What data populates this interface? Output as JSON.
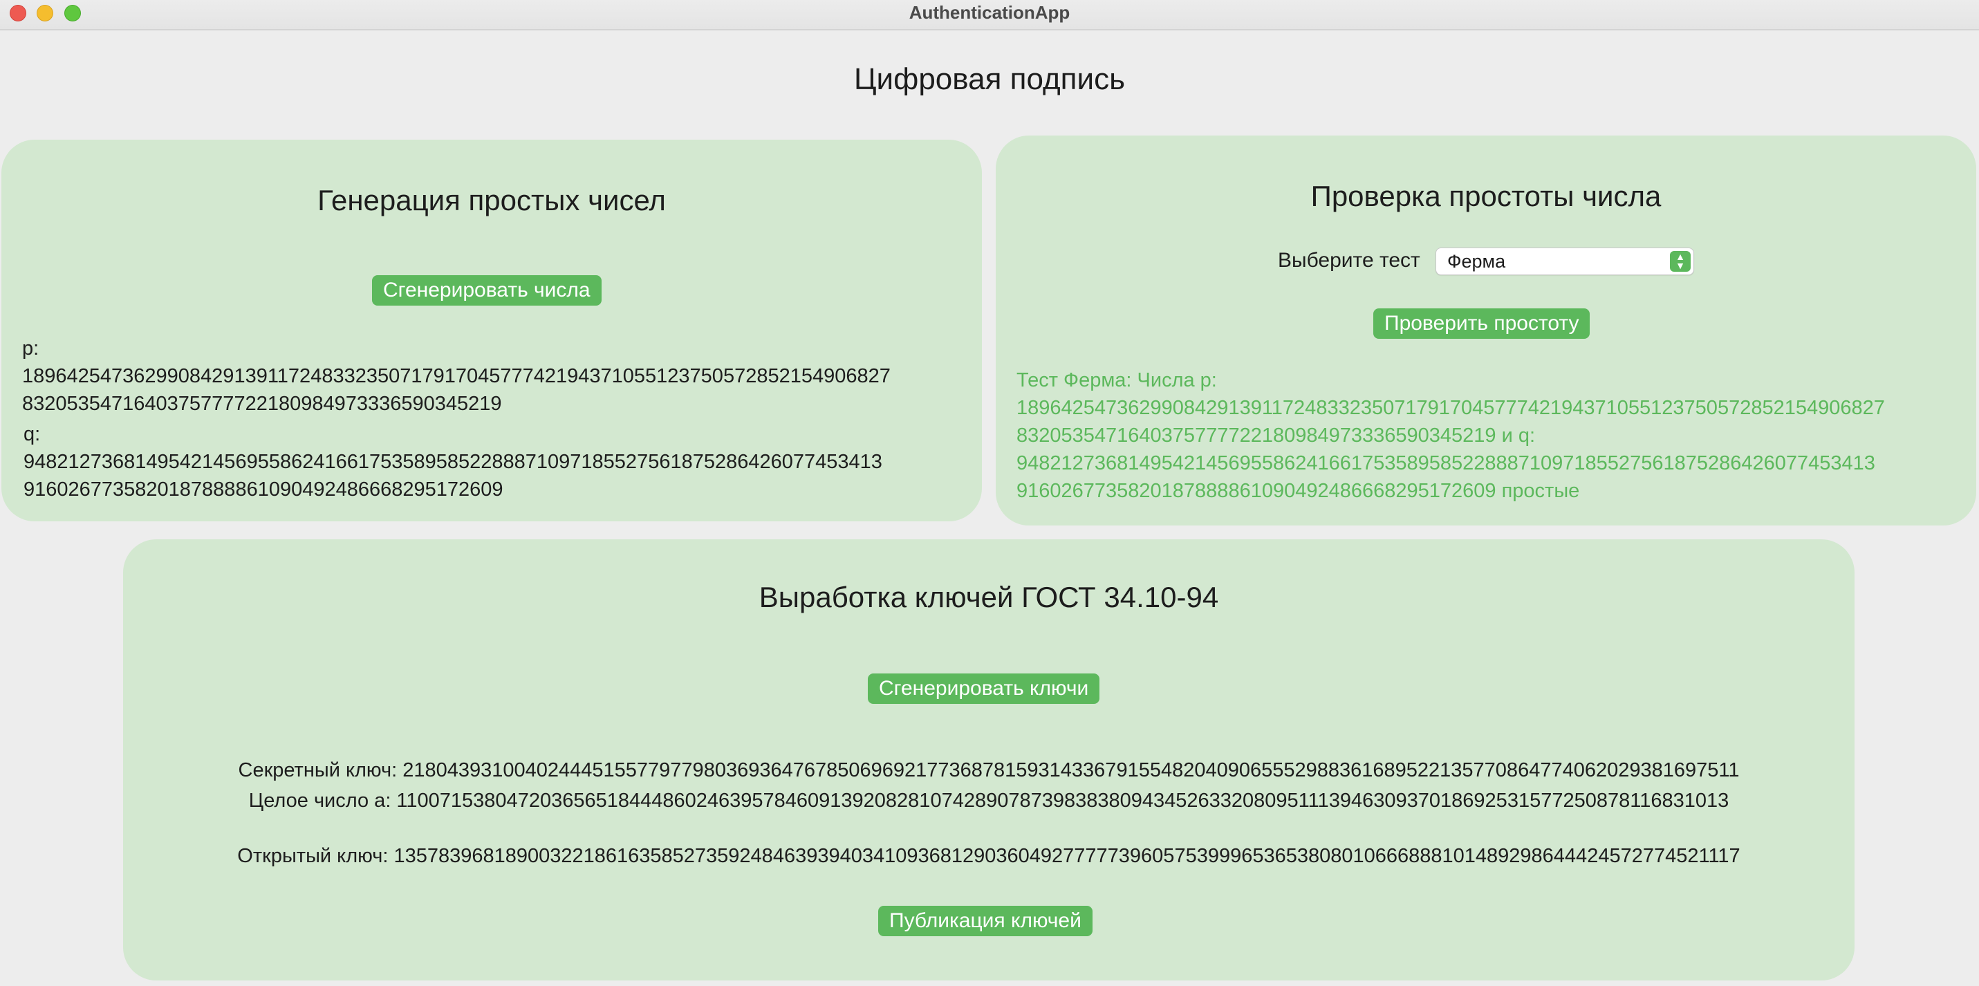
{
  "window": {
    "title": "AuthenticationApp"
  },
  "main": {
    "title": "Цифровая подпись"
  },
  "generation": {
    "title": "Генерация простых чисел",
    "generate_button": "Сгенерировать числа",
    "p_label": "p:",
    "p_value_line1": "1896425473629908429139117248332350717917045777421943710551237505728521549068​27",
    "p_value_line2": "832053547164037577772218098497333659034521​9",
    "q_label": "q:",
    "q_value_line1": "94821273681495421456955862416617535895852288871097185527561875286426077453413",
    "q_value_line2": "9160267735820187888861090492486668295172609"
  },
  "primality": {
    "title": "Проверка простоты числа",
    "select_label": "Выберите тест",
    "select_value": "Ферма",
    "check_button": "Проверить простоту",
    "result_line1": "Тест Ферма: Числа p:",
    "result_line2": "189642547362990842913911724833235071791704577742194371055123750572852154906827",
    "result_line3": "8320535471640375777722180984973336590345219 и q:",
    "result_line4": "94821273681495421456955862416617535895852288871097185527561875286426077453413",
    "result_line5": "9160267735820187888861090492486668295172609 простые"
  },
  "keys": {
    "title": "Выработка ключей ГОСТ 34.10-94",
    "generate_button": "Сгенерировать ключи",
    "secret_key": "Секретный ключ: 2180439310040244451557797798036936476785069692177368781593143367915548204090655529883616895221357708647740620293816975​11",
    "integer_a": "Целое число а: 110071538047203656518444860246395784609139208281074289078739838380943452633208095111394630937018692531577250878116831013",
    "public_key": "Открытый ключ: 135783968189003221861635852735924846393940341093681290360492777773960575399965365380801066688810148929864442457277452​1117",
    "publish_button": "Публикация ключей"
  },
  "colors": {
    "accent": "#5cb85c",
    "panel": "#d3e8d0",
    "background": "#ededed"
  }
}
